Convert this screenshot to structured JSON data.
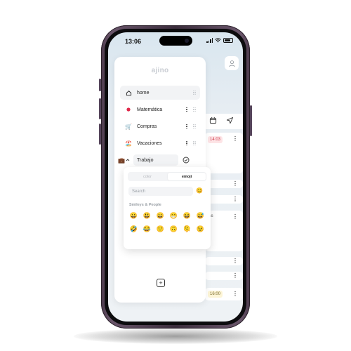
{
  "status_bar": {
    "time": "13:06"
  },
  "app": {
    "logo": "ajino"
  },
  "sidebar": {
    "items": [
      {
        "icon": "home-icon",
        "glyph": "⌂",
        "label": "home",
        "active": true
      },
      {
        "icon": "red-dot-icon",
        "glyph": "●",
        "label": "Matemática",
        "active": false
      },
      {
        "icon": "shopping-cart-icon",
        "glyph": "🛒",
        "label": "Compras",
        "active": false
      },
      {
        "icon": "beach-umbrella-icon",
        "glyph": "🏖️",
        "label": "Vacaciones",
        "active": false
      }
    ],
    "editing": {
      "emoji": "💼",
      "value": "Trabajo"
    },
    "add_label": "+"
  },
  "emoji_picker": {
    "tabs": [
      {
        "label": "color",
        "active": false
      },
      {
        "label": "emoji",
        "active": true
      }
    ],
    "search_placeholder": "Search",
    "skin_tone": "😊",
    "category": "Smileys & People",
    "emojis": [
      "😀",
      "😃",
      "😄",
      "😁",
      "😆",
      "😅",
      "🤣",
      "😂",
      "🙂",
      "🙃",
      "🫠",
      "😉"
    ]
  },
  "background": {
    "time_chips": [
      "14:03",
      "16:00"
    ],
    "partial_text": "ons"
  },
  "colors": {
    "dot_red": "#e0284a",
    "chip_red_bg": "#fde4e6",
    "chip_yellow_bg": "#fdf5d6"
  }
}
